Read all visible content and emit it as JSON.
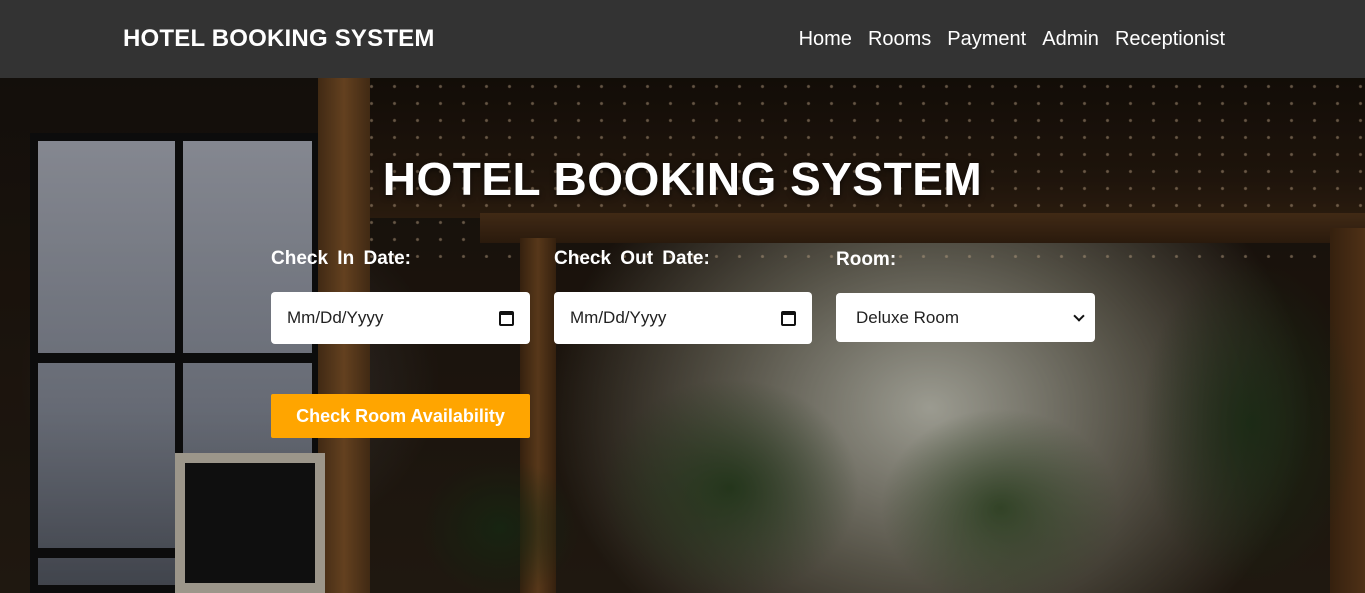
{
  "navbar": {
    "brand": "HOTEL BOOKING SYSTEM",
    "links": [
      "Home",
      "Rooms",
      "Payment",
      "Admin",
      "Receptionist"
    ]
  },
  "hero": {
    "title": "HOTEL BOOKING SYSTEM"
  },
  "form": {
    "check_in_label": "Check In Date:",
    "check_in_value": "Mm/Dd/Yyyy",
    "check_out_label": "Check Out Date:",
    "check_out_value": "Mm/Dd/Yyyy",
    "room_label": "Room:",
    "room_selected": "Deluxe Room",
    "submit_label": "Check Room Availability"
  },
  "colors": {
    "navbar_bg": "#333333",
    "accent": "#ffa500",
    "text": "#ffffff"
  },
  "icons": {
    "date_picker": "calendar-icon",
    "select": "chevron-down-icon"
  }
}
